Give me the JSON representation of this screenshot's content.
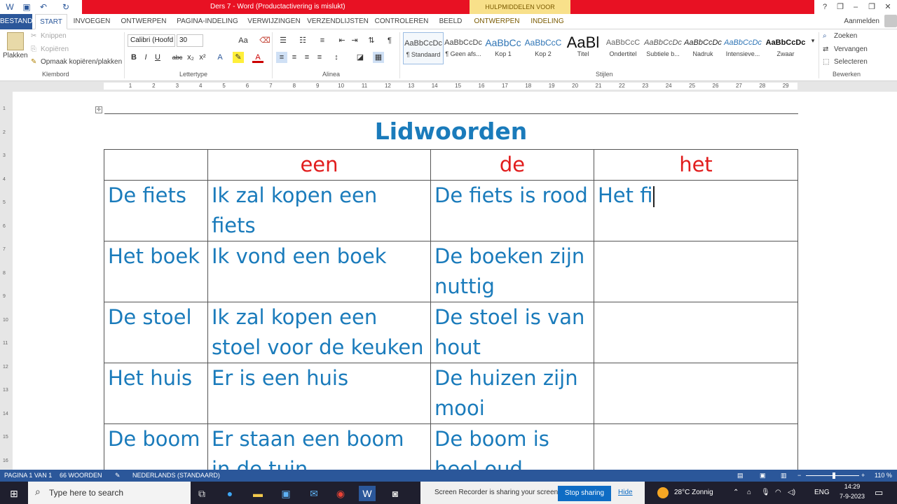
{
  "window": {
    "title": "Ders 7 - Word (Productactivering is mislukt)",
    "context_tab": "HULPMIDDELEN VOOR TABELLEN",
    "sign_in": "Aanmelden",
    "help": "?",
    "minimize": "–",
    "restore": "❐",
    "close": "✕"
  },
  "tabs": [
    "BESTAND",
    "START",
    "INVOEGEN",
    "ONTWERPEN",
    "PAGINA-INDELING",
    "VERWIJZINGEN",
    "VERZENDLIJSTEN",
    "CONTROLEREN",
    "BEELD",
    "ONTWERPEN",
    "INDELING"
  ],
  "ribbon": {
    "clipboard": {
      "paste": "Plakken",
      "cut": "Knippen",
      "copy": "Kopiëren",
      "format_painter": "Opmaak kopiëren/plakken",
      "label": "Klembord"
    },
    "font": {
      "name": "Calibri (Hoofd",
      "size": "30",
      "label": "Lettertype",
      "bold": "B",
      "italic": "I",
      "underline": "U",
      "strike": "abc",
      "sub": "x₂",
      "sup": "x²",
      "grow": "Aa"
    },
    "paragraph": {
      "label": "Alinea"
    },
    "styles": {
      "label": "Stijlen",
      "items": [
        {
          "preview": "AaBbCcDc",
          "name": "¶ Standaard"
        },
        {
          "preview": "AaBbCcDc",
          "name": "¶ Geen afs..."
        },
        {
          "preview": "AaBbCc",
          "name": "Kop 1"
        },
        {
          "preview": "AaBbCcC",
          "name": "Kop 2"
        },
        {
          "preview": "AaBl",
          "name": "Titel"
        },
        {
          "preview": "AaBbCcC",
          "name": "Ondertitel"
        },
        {
          "preview": "AaBbCcDc",
          "name": "Subtiele b..."
        },
        {
          "preview": "AaBbCcDc",
          "name": "Nadruk"
        },
        {
          "preview": "AaBbCcDc",
          "name": "Intensieve..."
        },
        {
          "preview": "AaBbCcDc",
          "name": "Zwaar"
        }
      ]
    },
    "editing": {
      "find": "Zoeken",
      "replace": "Vervangen",
      "select": "Selecteren",
      "label": "Bewerken"
    }
  },
  "ruler": {
    "numbers": [
      "1",
      "2",
      "3",
      "4",
      "5",
      "6",
      "7",
      "8",
      "9",
      "10",
      "11",
      "12",
      "13",
      "14",
      "15",
      "16",
      "17",
      "18",
      "19",
      "20",
      "21",
      "22",
      "23",
      "24",
      "25",
      "26",
      "27",
      "28",
      "29"
    ]
  },
  "vruler": {
    "numbers": [
      "1",
      "2",
      "3",
      "4",
      "5",
      "6",
      "7",
      "8",
      "9",
      "10",
      "11",
      "12",
      "13",
      "14",
      "15",
      "16"
    ]
  },
  "document": {
    "title": "Lidwoorden",
    "headers": [
      "",
      "een",
      "de",
      "het"
    ],
    "rows": [
      [
        "De fiets",
        "Ik zal kopen een fiets",
        "De fiets is rood",
        "Het fi"
      ],
      [
        "Het boek",
        "Ik vond een boek",
        "De boeken zijn nuttig",
        ""
      ],
      [
        "De stoel",
        "Ik zal kopen een stoel voor de keuken",
        "De stoel is van hout",
        ""
      ],
      [
        "Het huis",
        "Er is een huis",
        "De huizen zijn mooi",
        ""
      ],
      [
        "De boom",
        "Er staan een boom in de tuin",
        "De boom is heel oud",
        ""
      ]
    ]
  },
  "status": {
    "page": "PAGINA 1 VAN 1",
    "words": "66 WOORDEN",
    "language": "NEDERLANDS (STANDAARD)",
    "zoom": "110 %",
    "zoom_level": 1.1
  },
  "taskbar": {
    "search_placeholder": "Type here to search",
    "share_text": "Screen Recorder is sharing your screen.",
    "stop_sharing": "Stop sharing",
    "hide": "Hide",
    "weather": "28°C Zonnig",
    "lang": "ENG",
    "time": "14:29",
    "date": "7-9-2023"
  },
  "colors": {
    "word_blue": "#2b579a",
    "title_red": "#e81123",
    "table_text": "#1a7bbb",
    "header_red": "#e11d1d"
  }
}
